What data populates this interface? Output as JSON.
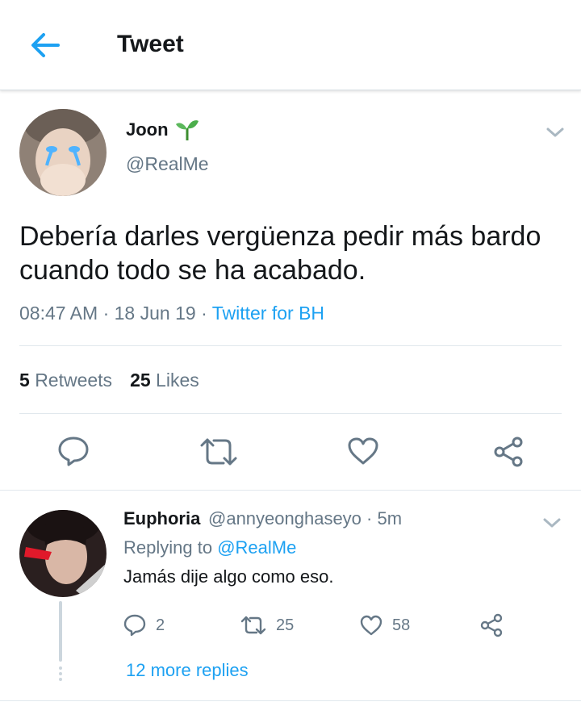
{
  "header": {
    "title": "Tweet"
  },
  "tweet": {
    "author_name": "Joon",
    "author_handle": "@RealMe",
    "text": "Debería darles vergüenza pedir más bardo cuando todo se ha acabado.",
    "time": "08:47 AM",
    "sep1": "·",
    "date": "18 Jun 19",
    "sep2": "·",
    "source": "Twitter for BH",
    "retweets_count": "5",
    "retweets_label": "Retweets",
    "likes_count": "25",
    "likes_label": "Likes"
  },
  "reply": {
    "author_name": "Euphoria",
    "handle_and_time": "@annyeonghaseyo · 5m",
    "replying_prefix": "Replying to",
    "replying_to": "@RealMe",
    "text": "Jamás dije algo como eso.",
    "reply_count": "2",
    "retweet_count": "25",
    "like_count": "58"
  },
  "thread": {
    "more_replies": "12 more replies"
  },
  "colors": {
    "accent": "#1da1f2",
    "secondary_text": "#657786",
    "primary_text": "#14171a",
    "divider": "#e1e8ed"
  },
  "icons": {
    "back": "arrow-left-icon",
    "emoji": "seedling-icon",
    "menu": "chevron-down-icon",
    "reply": "comment-icon",
    "retweet": "retweet-icon",
    "like": "heart-icon",
    "share": "share-icon"
  }
}
